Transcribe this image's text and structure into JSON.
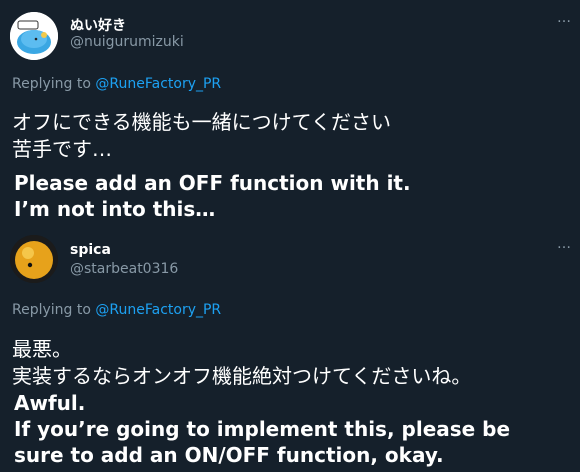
{
  "tweets": [
    {
      "display_name": "ぬい好き",
      "handle": "@nuigurumizuki",
      "replying_prefix": "Replying to ",
      "replying_to": "@RuneFactory_PR",
      "text_lines": [
        "オフにできる機能も一緒につけてください",
        "苦手です…"
      ],
      "caption_lines": [
        "Please add an OFF function with it.",
        "I’m not into this…"
      ]
    },
    {
      "display_name": "spica",
      "handle": "@starbeat0316",
      "replying_prefix": "Replying to ",
      "replying_to": "@RuneFactory_PR",
      "text_lines": [
        "最悪。",
        "実装するならオンオフ機能絶対つけてくださいね。"
      ],
      "caption_lines": [
        "Awful.",
        "If you’re going to implement this, please be",
        "sure to add an ON/OFF function, okay."
      ]
    }
  ],
  "more_glyph": "…",
  "colors": {
    "background": "#15202b",
    "text": "#ffffff",
    "muted": "#8899a6",
    "link": "#1da1f2"
  }
}
